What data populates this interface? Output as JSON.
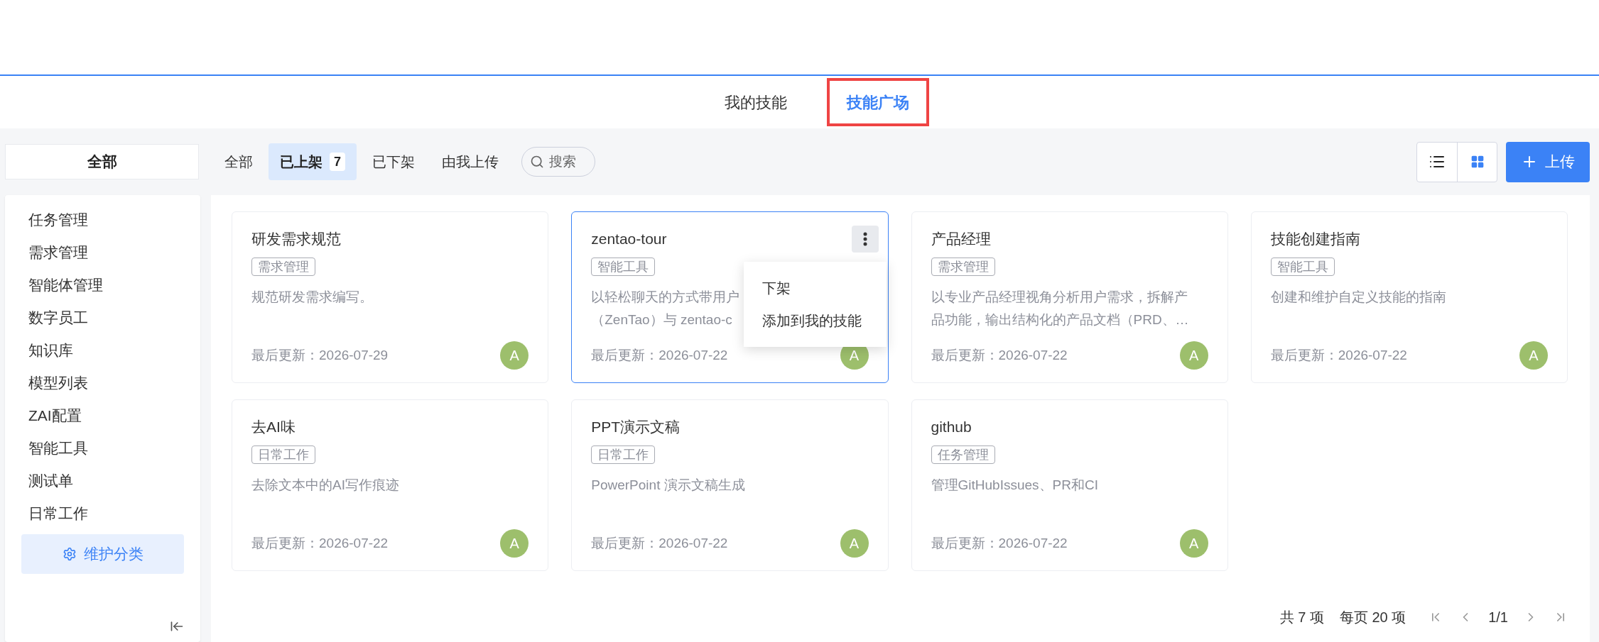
{
  "view_tabs": [
    {
      "label": "我的技能",
      "selected": false,
      "highlighted": false
    },
    {
      "label": "技能广场",
      "selected": true,
      "highlighted": true
    }
  ],
  "category_crumb": "全部",
  "status_filters": [
    {
      "label": "全部",
      "selected": false
    },
    {
      "label": "已上架",
      "selected": true,
      "count": "7"
    },
    {
      "label": "已下架",
      "selected": false
    },
    {
      "label": "由我上传",
      "selected": false
    }
  ],
  "search": {
    "placeholder": "搜索"
  },
  "view_modes": [
    {
      "kind": "list",
      "selected": false
    },
    {
      "kind": "grid",
      "selected": true
    }
  ],
  "upload_button": "上传",
  "sidebar": {
    "items": [
      "任务管理",
      "需求管理",
      "智能体管理",
      "数字员工",
      "知识库",
      "模型列表",
      "ZAI配置",
      "智能工具",
      "测试单",
      "日常工作"
    ],
    "maintain_button": "维护分类"
  },
  "cards": [
    {
      "title": "研发需求规范",
      "tag": "需求管理",
      "description": [
        "规范研发需求编写。"
      ],
      "updated": "最后更新：2026-07-29",
      "avatar": "A",
      "selected": false
    },
    {
      "title": "zentao-tour",
      "tag": "智能工具",
      "description": [
        "以轻松聊天的方式带用户",
        "（ZenTao）与 zentao-c"
      ],
      "updated": "最后更新：2026-07-22",
      "avatar": "A",
      "selected": true,
      "menu": [
        "下架",
        "添加到我的技能"
      ]
    },
    {
      "title": "产品经理",
      "tag": "需求管理",
      "description": [
        "以专业产品经理视角分析用户需求，拆解产",
        "品功能，输出结构化的产品文档（PRD、…"
      ],
      "updated": "最后更新：2026-07-22",
      "avatar": "A",
      "selected": false
    },
    {
      "title": "技能创建指南",
      "tag": "智能工具",
      "description": [
        "创建和维护自定义技能的指南"
      ],
      "updated": "最后更新：2026-07-22",
      "avatar": "A",
      "selected": false
    },
    {
      "title": "去AI味",
      "tag": "日常工作",
      "description": [
        "去除文本中的AI写作痕迹"
      ],
      "updated": "最后更新：2026-07-22",
      "avatar": "A",
      "selected": false
    },
    {
      "title": "PPT演示文稿",
      "tag": "日常工作",
      "description": [
        "PowerPoint 演示文稿生成"
      ],
      "updated": "最后更新：2026-07-22",
      "avatar": "A",
      "selected": false
    },
    {
      "title": "github",
      "tag": "任务管理",
      "description": [
        "管理GitHubIssues、PR和CI"
      ],
      "updated": "最后更新：2026-07-22",
      "avatar": "A",
      "selected": false
    }
  ],
  "pagination": {
    "total": "共 7 项",
    "per_page": "每页 20 项",
    "page": "1/1"
  }
}
